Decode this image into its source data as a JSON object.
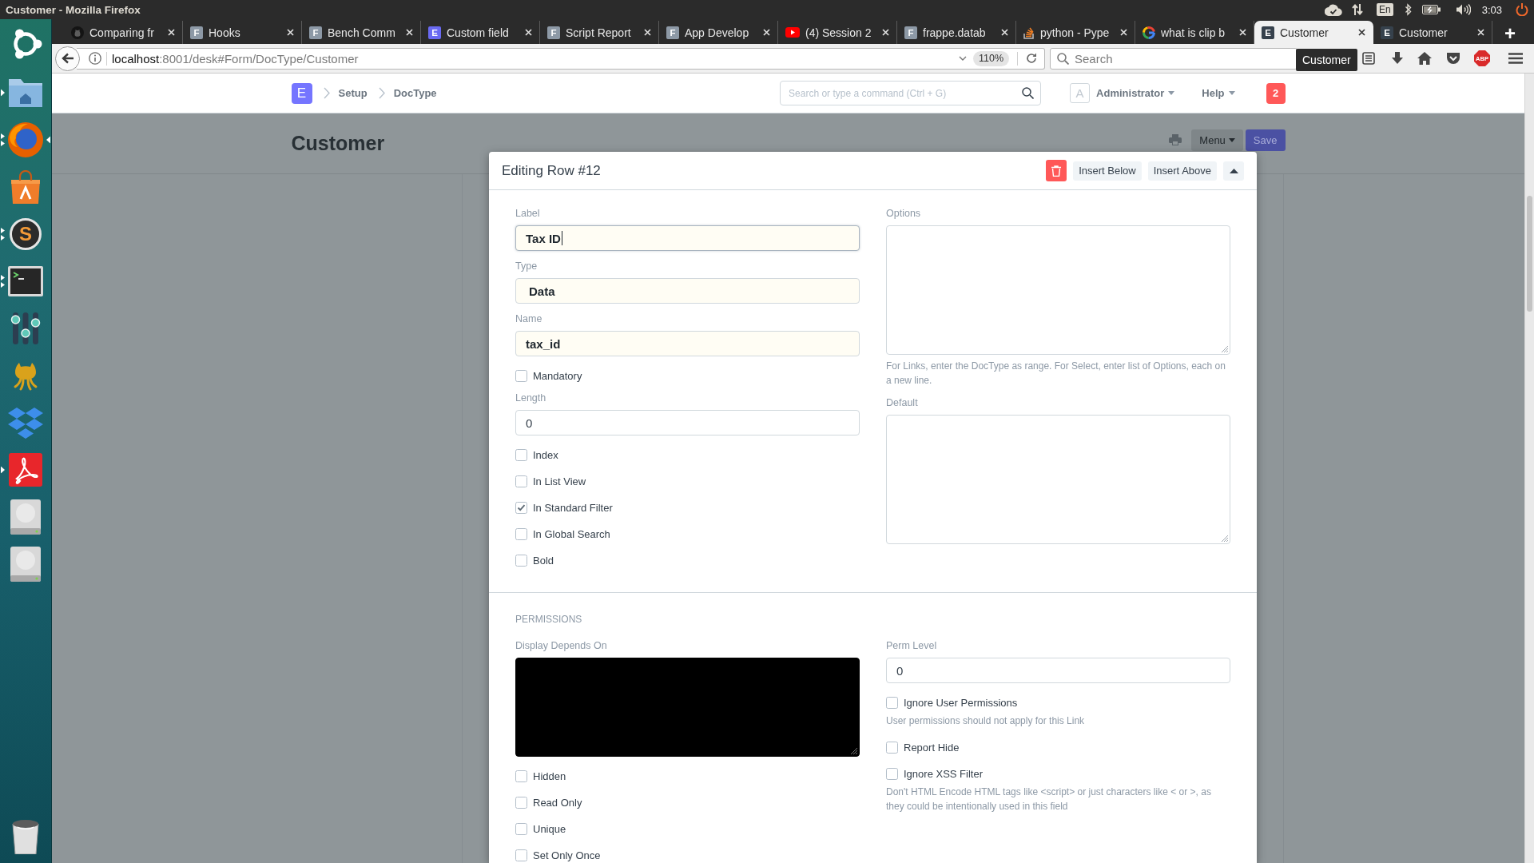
{
  "top_panel": {
    "title": "Customer - Mozilla Firefox",
    "keyboard_layout": "En",
    "clock": "3:03"
  },
  "dock": {
    "items": [
      {
        "kind": "dash",
        "running": false,
        "focused": false
      },
      {
        "kind": "files",
        "running": true,
        "several_windows": false,
        "focused": false
      },
      {
        "kind": "browser",
        "running": true,
        "several_windows": true,
        "focused": true
      },
      {
        "kind": "store",
        "running": false,
        "focused": false
      },
      {
        "kind": "editor",
        "glyph": "S",
        "running": true,
        "several_windows": true,
        "focused": false
      },
      {
        "kind": "terminal",
        "running": true,
        "several_windows": true,
        "focused": false
      },
      {
        "kind": "mixer",
        "running": false,
        "focused": false
      },
      {
        "kind": "cat",
        "running": false,
        "focused": false
      },
      {
        "kind": "dropbox",
        "running": false,
        "focused": false
      },
      {
        "kind": "reader",
        "running": true,
        "several_windows": false,
        "focused": false
      },
      {
        "kind": "drive",
        "running": false,
        "focused": false
      },
      {
        "kind": "drive",
        "running": false,
        "focused": false
      }
    ],
    "bottom_items": [
      {
        "kind": "trash",
        "running": false,
        "focused": false
      }
    ]
  },
  "tab_strip": {
    "tabs": [
      {
        "title": "Comparing fr",
        "favicon": {
          "kind": "cat"
        },
        "selected": false
      },
      {
        "title": "Hooks",
        "favicon": {
          "kind": "letter",
          "text": "F",
          "color": "#8d99a6"
        },
        "selected": false
      },
      {
        "title": "Bench Comm",
        "favicon": {
          "kind": "letter",
          "text": "F",
          "color": "#8d99a6"
        },
        "selected": false
      },
      {
        "title": "Custom field",
        "favicon": {
          "kind": "letter",
          "text": "E",
          "color": "#6a6af2"
        },
        "selected": false
      },
      {
        "title": "Script Report",
        "favicon": {
          "kind": "letter",
          "text": "F",
          "color": "#8d99a6"
        },
        "selected": false
      },
      {
        "title": "App Develop",
        "favicon": {
          "kind": "letter",
          "text": "F",
          "color": "#8d99a6"
        },
        "selected": false
      },
      {
        "title": "(4) Session 2",
        "favicon": {
          "kind": "play"
        },
        "selected": false
      },
      {
        "title": "frappe.datab",
        "favicon": {
          "kind": "letter",
          "text": "F",
          "color": "#8d99a6"
        },
        "selected": false
      },
      {
        "title": "python - Pype",
        "favicon": {
          "kind": "stack"
        },
        "selected": false
      },
      {
        "title": "what is clip b",
        "favicon": {
          "kind": "ring"
        },
        "selected": false
      },
      {
        "title": "Customer",
        "favicon": {
          "kind": "letter",
          "text": "E",
          "color": "#36414c"
        },
        "selected": true
      },
      {
        "title": "Customer",
        "favicon": {
          "kind": "letter",
          "text": "E",
          "color": "#36414c"
        },
        "selected": false
      }
    ],
    "new_tab": "+"
  },
  "navbar": {
    "address": {
      "host": "localhost",
      "path": ":8001/desk#Form/DocType/Customer"
    },
    "zoom": "110%",
    "search_placeholder": "Search",
    "tooltip": "Customer",
    "extension_label": "ABP"
  },
  "app_header": {
    "logo": "E",
    "breadcrumbs": [
      "Setup",
      "DocType"
    ],
    "search_placeholder": "Search or type a command (Ctrl + G)",
    "avatar": "A",
    "user": "Administrator",
    "help": "Help",
    "notifications": "2"
  },
  "page": {
    "title": "Customer",
    "menu": "Menu",
    "save": "Save"
  },
  "editor": {
    "title": "Editing Row #12",
    "actions": [
      {
        "kind": "delete"
      },
      {
        "kind": "button",
        "label": "Insert Below"
      },
      {
        "kind": "button",
        "label": "Insert Above"
      },
      {
        "kind": "collapse"
      }
    ],
    "sections": [
      {
        "columns": [
          [
            {
              "kind": "input",
              "label": "Label",
              "value": "Tax ID",
              "highlighted": true,
              "focused": true
            },
            {
              "kind": "select",
              "label": "Type",
              "value": "Data",
              "highlighted": true
            },
            {
              "kind": "input",
              "label": "Name",
              "value": "tax_id",
              "highlighted": true,
              "focused": false
            },
            {
              "kind": "checkbox",
              "label": "Mandatory",
              "checked": false
            },
            {
              "kind": "input",
              "label": "Length",
              "value": "0",
              "highlighted": false,
              "focused": false
            },
            {
              "kind": "checkbox",
              "label": "Index",
              "checked": false
            },
            {
              "kind": "checkbox",
              "label": "In List View",
              "checked": false
            },
            {
              "kind": "checkbox",
              "label": "In Standard Filter",
              "checked": true
            },
            {
              "kind": "checkbox",
              "label": "In Global Search",
              "checked": false
            },
            {
              "kind": "checkbox",
              "label": "Bold",
              "checked": false
            }
          ],
          [
            {
              "kind": "textarea",
              "label": "Options",
              "description": "For Links, enter the DocType as range. For Select, enter list of Options, each on a new line."
            },
            {
              "kind": "textarea",
              "label": "Default"
            }
          ]
        ]
      },
      {
        "heading": "PERMISSIONS",
        "columns": [
          [
            {
              "kind": "code",
              "label": "Display Depends On"
            },
            {
              "kind": "checkbox",
              "label": "Hidden",
              "checked": false
            },
            {
              "kind": "checkbox",
              "label": "Read Only",
              "checked": false
            },
            {
              "kind": "checkbox",
              "label": "Unique",
              "checked": false
            },
            {
              "kind": "checkbox",
              "label": "Set Only Once",
              "checked": false
            }
          ],
          [
            {
              "kind": "input",
              "label": "Perm Level",
              "value": "0",
              "highlighted": false,
              "focused": false
            },
            {
              "kind": "checkbox",
              "label": "Ignore User Permissions",
              "checked": false,
              "description": "User permissions should not apply for this Link"
            },
            {
              "kind": "checkbox",
              "label": "Report Hide",
              "checked": false
            },
            {
              "kind": "checkbox",
              "label": "Ignore XSS Filter",
              "checked": false,
              "description": "Don't HTML Encode HTML tags like <script> or just characters like < or >, as they could be intentionally used in this field"
            }
          ]
        ]
      }
    ]
  }
}
